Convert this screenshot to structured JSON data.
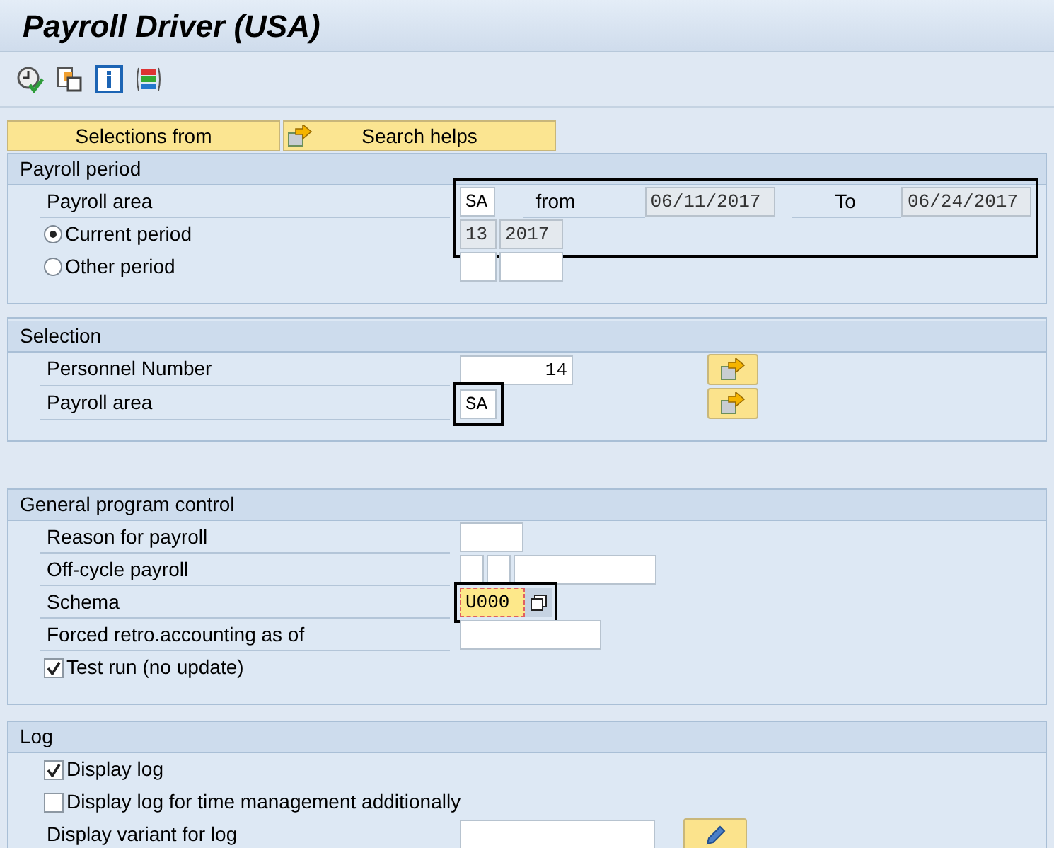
{
  "title": "Payroll Driver (USA)",
  "action_buttons": [
    {
      "label": "Selections from",
      "icon": false
    },
    {
      "label": "Search helps",
      "icon": true
    }
  ],
  "payroll_period": {
    "title": "Payroll period",
    "highlighted": true,
    "payroll_area": {
      "label": "Payroll area",
      "value": "SA"
    },
    "from": {
      "label": "from",
      "value": "06/11/2017"
    },
    "to": {
      "label": "To",
      "value": "06/24/2017"
    },
    "options": [
      {
        "label": "Current period",
        "selected": true,
        "period": "13",
        "year": "2017"
      },
      {
        "label": "Other period",
        "selected": false
      }
    ]
  },
  "selection": {
    "title": "Selection",
    "rows": [
      {
        "label": "Personnel Number",
        "value": "14",
        "highlighted": false
      },
      {
        "label": "Payroll area",
        "value": "SA",
        "highlighted": true
      }
    ]
  },
  "general": {
    "title": "General program control",
    "reason": {
      "label": "Reason for payroll"
    },
    "off_cycle": {
      "label": "Off-cycle payroll"
    },
    "schema": {
      "label": "Schema",
      "value": "U000",
      "highlighted": true
    },
    "retro": {
      "label": "Forced retro.accounting as of"
    },
    "test_run": {
      "label": "Test run (no update)",
      "checked": true
    }
  },
  "log": {
    "title": "Log",
    "checks": [
      {
        "label": "Display log",
        "checked": true
      },
      {
        "label": "Display log for time management additionally",
        "checked": false
      }
    ],
    "variant": {
      "label": "Display variant for log"
    }
  }
}
